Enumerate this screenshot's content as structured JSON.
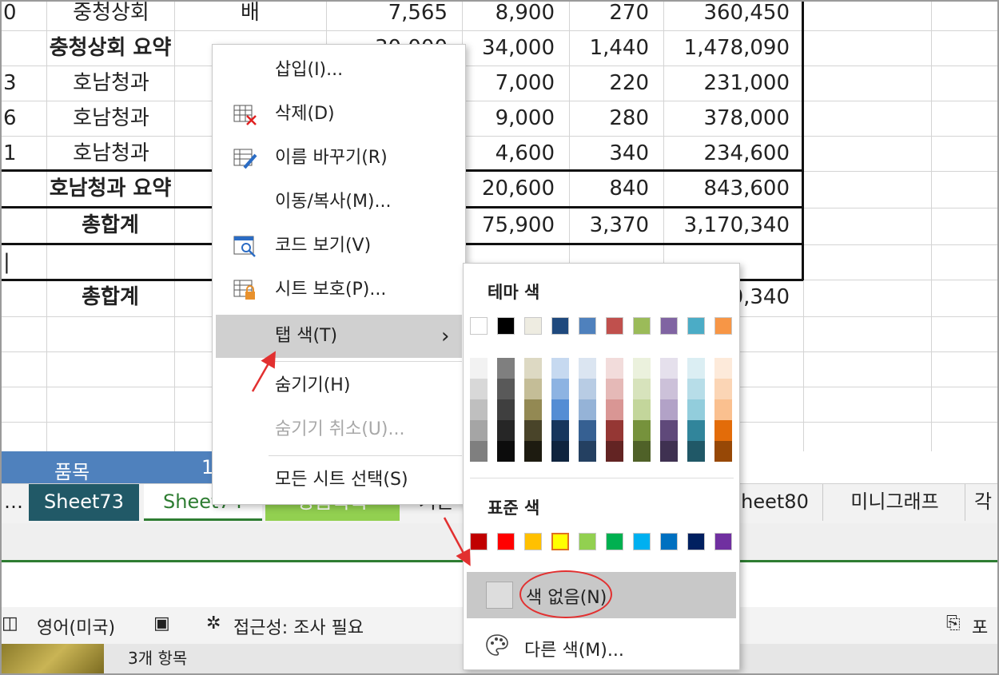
{
  "table": {
    "rows": [
      {
        "a": "0",
        "b": "중청상회",
        "c": "배",
        "d": "7,565",
        "e": "8,900",
        "f": "270",
        "g": "360,450"
      },
      {
        "title": "충청상회 요약",
        "d": "30,000",
        "e": "34,000",
        "f": "1,440",
        "g": "1,478,090"
      },
      {
        "a": "3",
        "b": "호남청과",
        "e": "7,000",
        "f": "220",
        "g": "231,000"
      },
      {
        "a": "6",
        "b": "호남청과",
        "e": "9,000",
        "f": "280",
        "g": "378,000"
      },
      {
        "a": "1",
        "b": "호남청과",
        "e": "4,600",
        "f": "340",
        "g": "234,600"
      },
      {
        "title": "호남청과 요약",
        "e": "20,600",
        "f": "840",
        "g": "843,600"
      },
      {
        "title": "총합계",
        "e": "75,900",
        "f": "3,370",
        "g": "3,170,340"
      },
      {
        "a": "|"
      },
      {
        "title": "총합계",
        "g": "0,340"
      }
    ],
    "blue_row": {
      "label": "품목",
      "value": "1"
    }
  },
  "tabs": {
    "nav": "…",
    "items": [
      "Sheet73",
      "Sheet74",
      "상품목록",
      "기본",
      "heet80",
      "미니그래프",
      "각"
    ]
  },
  "statusbar": {
    "lang": "영어(미국)",
    "accessibility": "접근성: 조사 필요",
    "right": "포",
    "taskbar_item": "3개 항목"
  },
  "menu": {
    "items": [
      {
        "label": "삽입(I)...",
        "icon": ""
      },
      {
        "label": "삭제(D)",
        "icon": "delete-sheet-icon"
      },
      {
        "label": "이름 바꾸기(R)",
        "icon": "rename-sheet-icon"
      },
      {
        "label": "이동/복사(M)...",
        "icon": ""
      },
      {
        "label": "코드 보기(V)",
        "icon": "view-code-icon"
      },
      {
        "label": "시트 보호(P)...",
        "icon": "protect-sheet-icon"
      },
      {
        "label": "탭 색(T)",
        "icon": ""
      },
      {
        "label": "숨기기(H)",
        "icon": ""
      },
      {
        "label": "숨기기 취소(U)...",
        "icon": ""
      },
      {
        "label": "모든 시트 선택(S)",
        "icon": ""
      }
    ],
    "chevron": "›"
  },
  "submenu": {
    "theme_title": "테마 색",
    "standard_title": "표준 색",
    "no_color": "색 없음(N)",
    "more_colors": "다른 색(M)...",
    "theme_top": [
      "#ffffff",
      "#000000",
      "#eeece1",
      "#1f497d",
      "#4f81bd",
      "#c0504d",
      "#9bbb59",
      "#8064a2",
      "#4bacc6",
      "#f79646"
    ],
    "theme_shades": [
      [
        "#f2f2f2",
        "#d8d8d8",
        "#bfbfbf",
        "#a5a5a5",
        "#7f7f7f"
      ],
      [
        "#7f7f7f",
        "#595959",
        "#3f3f3f",
        "#262626",
        "#0c0c0c"
      ],
      [
        "#ddd9c3",
        "#c4bd97",
        "#938953",
        "#494429",
        "#1d1b10"
      ],
      [
        "#c6d9f0",
        "#8db3e2",
        "#548dd4",
        "#17365d",
        "#0f243e"
      ],
      [
        "#dbe5f1",
        "#b8cce4",
        "#95b3d7",
        "#366092",
        "#244061"
      ],
      [
        "#f2dcdb",
        "#e5b9b7",
        "#d99694",
        "#953734",
        "#632423"
      ],
      [
        "#ebf1dd",
        "#d7e3bc",
        "#c3d69b",
        "#76923c",
        "#4f6128"
      ],
      [
        "#e5e0ec",
        "#ccc1d9",
        "#b2a2c7",
        "#5f497a",
        "#3f3151"
      ],
      [
        "#dbeef3",
        "#b7dde8",
        "#92cddc",
        "#31859b",
        "#205867"
      ],
      [
        "#fdeada",
        "#fbd5b5",
        "#fac08f",
        "#e36c09",
        "#974806"
      ]
    ],
    "standard": [
      "#c00000",
      "#ff0000",
      "#ffc000",
      "#ffff00",
      "#92d050",
      "#00b050",
      "#00b0f0",
      "#0070c0",
      "#002060",
      "#7030a0"
    ]
  },
  "colors": {
    "accent": "#4f81bd",
    "tab_teal": "#215967",
    "tab_green": "#92d050",
    "annotation": "#e23030"
  }
}
